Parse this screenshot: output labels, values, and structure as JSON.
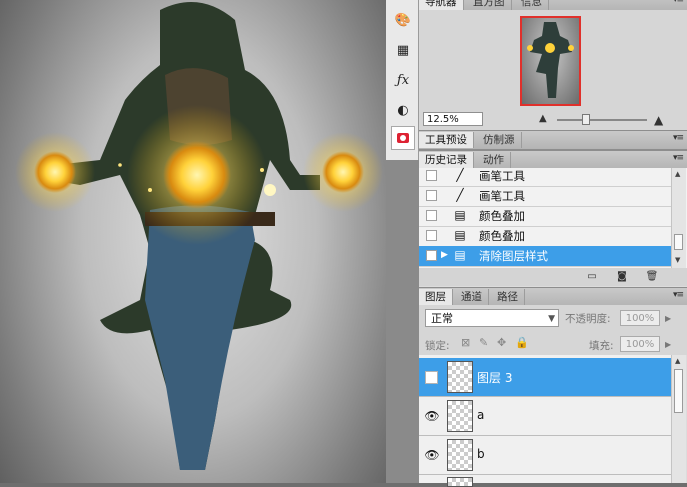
{
  "canvas": {
    "description_image": "dancer-with-glowing-orbs"
  },
  "tool_icons": [
    "brush-preset-icon",
    "grid-icon",
    "fx-icon",
    "mask-circle-icon",
    "quick-mask-icon"
  ],
  "navigator": {
    "tabs": [
      "导航器",
      "直方图",
      "信息"
    ],
    "zoom": "12.5%"
  },
  "tool_presets": {
    "tabs": [
      "工具预设",
      "仿制源"
    ]
  },
  "history": {
    "tabs": [
      "历史记录",
      "动作"
    ],
    "items": [
      {
        "label": "画笔工具",
        "icon": "brush-icon"
      },
      {
        "label": "画笔工具",
        "icon": "brush-icon"
      },
      {
        "label": "颜色叠加",
        "icon": "document-icon"
      },
      {
        "label": "颜色叠加",
        "icon": "document-icon"
      },
      {
        "label": "清除图层样式",
        "icon": "document-icon"
      }
    ],
    "selected_index": 4
  },
  "layers": {
    "tabs": [
      "图层",
      "通道",
      "路径"
    ],
    "blend_mode": "正常",
    "opacity_label": "不透明度:",
    "opacity_value": "100%",
    "lock_label": "锁定:",
    "fill_label": "填充:",
    "fill_value": "100%",
    "items": [
      {
        "name": "图层 3",
        "visible": false
      },
      {
        "name": "a",
        "visible": true
      },
      {
        "name": "b",
        "visible": true
      }
    ]
  },
  "colors": {
    "selection": "#3d9ee8",
    "nav_frame": "#e0302b",
    "glow": "#ffd84a"
  }
}
